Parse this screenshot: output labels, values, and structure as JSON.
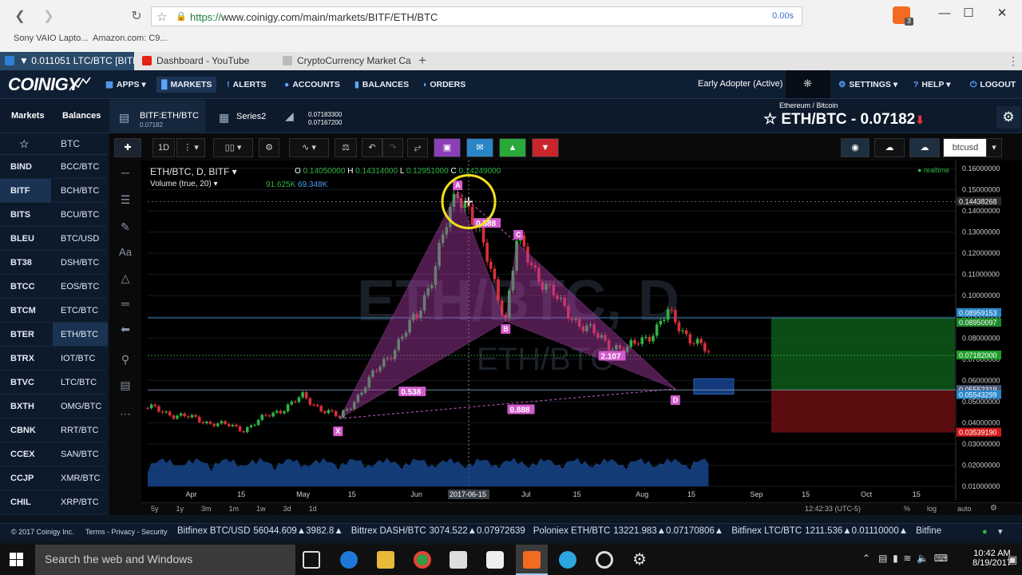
{
  "browser": {
    "url_scheme": "https://",
    "url_rest": "www.coinigy.com/main/markets/BITF/ETH/BTC",
    "load_time": "0.00s",
    "bookmarks": [
      "Sony VAIO Lapto...",
      "Amazon.com: C9..."
    ],
    "tabs": [
      {
        "label": "▼ 0.011051 LTC/BTC [BITF] -",
        "color": "#2f7fd6"
      },
      {
        "label": "Dashboard - YouTube",
        "color": "#e62117"
      },
      {
        "label": "CryptoCurrency Market Ca",
        "color": "#888888"
      }
    ],
    "new_tab": "+",
    "menu_dots": "⋮",
    "badge": "3"
  },
  "app": {
    "logo": "COINIGY",
    "menu": [
      {
        "label": "APPS ▾"
      },
      {
        "label": "MARKETS"
      },
      {
        "label": "ALERTS"
      },
      {
        "label": "ACCOUNTS"
      },
      {
        "label": "BALANCES"
      },
      {
        "label": "ORDERS"
      }
    ],
    "user_status": "Early Adopter (Active)",
    "right_menu": [
      {
        "label": "SETTINGS ▾"
      },
      {
        "label": "HELP ▾"
      },
      {
        "label": "LOGOUT"
      }
    ]
  },
  "subbar": {
    "tabs": [
      "Markets",
      "Balances"
    ],
    "chart_tab": {
      "title": "BITF:ETH/BTC",
      "sub": "0.07182"
    },
    "series_tab": "Series2",
    "quote_high": "0.07183300",
    "quote_low": "0.07167200",
    "pair_caption": "Ethereum / Bitcoin",
    "pair_title": "ETH/BTC - 0.07182",
    "pair_arrow": "⬇"
  },
  "left": {
    "search_label": "BTC",
    "exchanges": [
      "BIND",
      "BITF",
      "BITS",
      "BLEU",
      "BT38",
      "BTCC",
      "BTCM",
      "BTER",
      "BTRX",
      "BTVC",
      "BXTH",
      "CBNK",
      "CCEX",
      "CCJP",
      "CHIL"
    ],
    "markets": [
      "BCC/BTC",
      "BCH/BTC",
      "BCU/BTC",
      "BTC/USD",
      "DSH/BTC",
      "EOS/BTC",
      "ETC/BTC",
      "ETH/BTC",
      "IOT/BTC",
      "LTC/BTC",
      "OMG/BTC",
      "RRT/BTC",
      "SAN/BTC",
      "XMR/BTC",
      "XRP/BTC"
    ],
    "active_exchange": "BITF",
    "active_market": "ETH/BTC"
  },
  "toolbar": {
    "interval": "1D",
    "right_symbol": "btcusd"
  },
  "chart": {
    "legend_symbol": "ETH/BTC, D, BITF ▾",
    "ohlc": {
      "o_label": "O",
      "o": "0.14050000",
      "h_label": "H",
      "h": "0.14314000",
      "l_label": "L",
      "l": "0.12951000",
      "c_label": "C",
      "c": "0.14249000"
    },
    "volume_label": "Volume (true, 20) ▾",
    "volume_values": [
      "91.625K",
      "69.348K"
    ],
    "realtime": "realtime",
    "watermark_big": "ETH/BTC, D",
    "watermark_small": "ETH/BTC",
    "price_axis": [
      "0.16000000",
      "0.15000000",
      "0.14000000",
      "0.13000000",
      "0.12000000",
      "0.11000000",
      "0.10000000",
      "0.09000000",
      "0.08000000",
      "0.07000000",
      "0.06000000",
      "0.05000000",
      "0.04000000",
      "0.03000000",
      "0.02000000",
      "0.01000000"
    ],
    "price_tags": [
      {
        "text": "0.14438268",
        "bg": "#2a2a2a",
        "fg": "#ffffff"
      },
      {
        "text": "0.08959153",
        "bg": "#2a86c8",
        "fg": "#ffffff"
      },
      {
        "text": "0.08950097",
        "bg": "#1e8a2a",
        "fg": "#ffffff"
      },
      {
        "text": "0.07182000",
        "bg": "#1e9c2a",
        "fg": "#ffffff"
      },
      {
        "text": "0.05552319",
        "bg": "#4a5a7a",
        "fg": "#ffffff"
      },
      {
        "text": "0.05543299",
        "bg": "#2a86c8",
        "fg": "#ffffff"
      },
      {
        "text": "0.03539190",
        "bg": "#d41b1b",
        "fg": "#ffffff"
      }
    ],
    "time_axis": [
      "Apr",
      "15",
      "May",
      "15",
      "Jun",
      "2017-06-15",
      "Jul",
      "15",
      "Aug",
      "15",
      "Sep",
      "15",
      "Oct",
      "15"
    ],
    "ranges": [
      "5y",
      "1y",
      "3m",
      "1m",
      "1w",
      "3d",
      "1d"
    ],
    "clock": "12:42:33 (UTC-5)",
    "axis_opts": [
      "%",
      "log",
      "auto"
    ],
    "harmonic_labels": [
      "X",
      "A",
      "B",
      "C",
      "D"
    ],
    "ratios": [
      "0.538",
      "0.588",
      "0.888",
      "2.107"
    ]
  },
  "chart_data": {
    "type": "candlestick",
    "title": "ETH/BTC, D, BITF",
    "x_range": [
      "2017-03-20",
      "2017-08-19"
    ],
    "ylim": [
      0.01,
      0.16
    ],
    "last": 0.07182,
    "approx_closes": [
      {
        "x": "2017-03-20",
        "y": 0.047
      },
      {
        "x": "2017-04-01",
        "y": 0.042
      },
      {
        "x": "2017-04-15",
        "y": 0.037
      },
      {
        "x": "2017-05-01",
        "y": 0.052
      },
      {
        "x": "2017-05-11",
        "y": 0.042
      },
      {
        "x": "2017-05-20",
        "y": 0.062
      },
      {
        "x": "2017-06-01",
        "y": 0.09
      },
      {
        "x": "2017-06-05",
        "y": 0.11
      },
      {
        "x": "2017-06-12",
        "y": 0.149
      },
      {
        "x": "2017-06-15",
        "y": 0.143
      },
      {
        "x": "2017-06-25",
        "y": 0.09
      },
      {
        "x": "2017-06-28",
        "y": 0.125
      },
      {
        "x": "2017-07-10",
        "y": 0.095
      },
      {
        "x": "2017-07-20",
        "y": 0.08
      },
      {
        "x": "2017-07-28",
        "y": 0.074
      },
      {
        "x": "2017-08-05",
        "y": 0.085
      },
      {
        "x": "2017-08-08",
        "y": 0.091
      },
      {
        "x": "2017-08-19",
        "y": 0.072
      }
    ],
    "harmonic_pattern": {
      "X": 0.042,
      "A": 0.149,
      "B": 0.088,
      "C": 0.125,
      "D": 0.056
    }
  },
  "ticker": {
    "copyright": "© 2017 Coinigy Inc.",
    "links": "Terms - Privacy - Security",
    "items": [
      {
        "pair": "Bitfinex BTC/USD",
        "price": "56044.609",
        "delta": "▲3982.8▲"
      },
      {
        "pair": "Bittrex DASH/BTC",
        "price": "3074.522",
        "delta": "▲0.07972639"
      },
      {
        "pair": "Poloniex ETH/BTC",
        "price": "13221.983",
        "delta": "▲0.07170806▲"
      },
      {
        "pair": "Bitfinex LTC/BTC",
        "price": "1211.536",
        "delta": "▲0.01110000▲"
      },
      {
        "pair": "Bitfine",
        "price": "",
        "delta": ""
      }
    ]
  },
  "taskbar": {
    "search_placeholder": "Search the web and Windows",
    "time": "10:42 AM",
    "date": "8/19/2017"
  }
}
